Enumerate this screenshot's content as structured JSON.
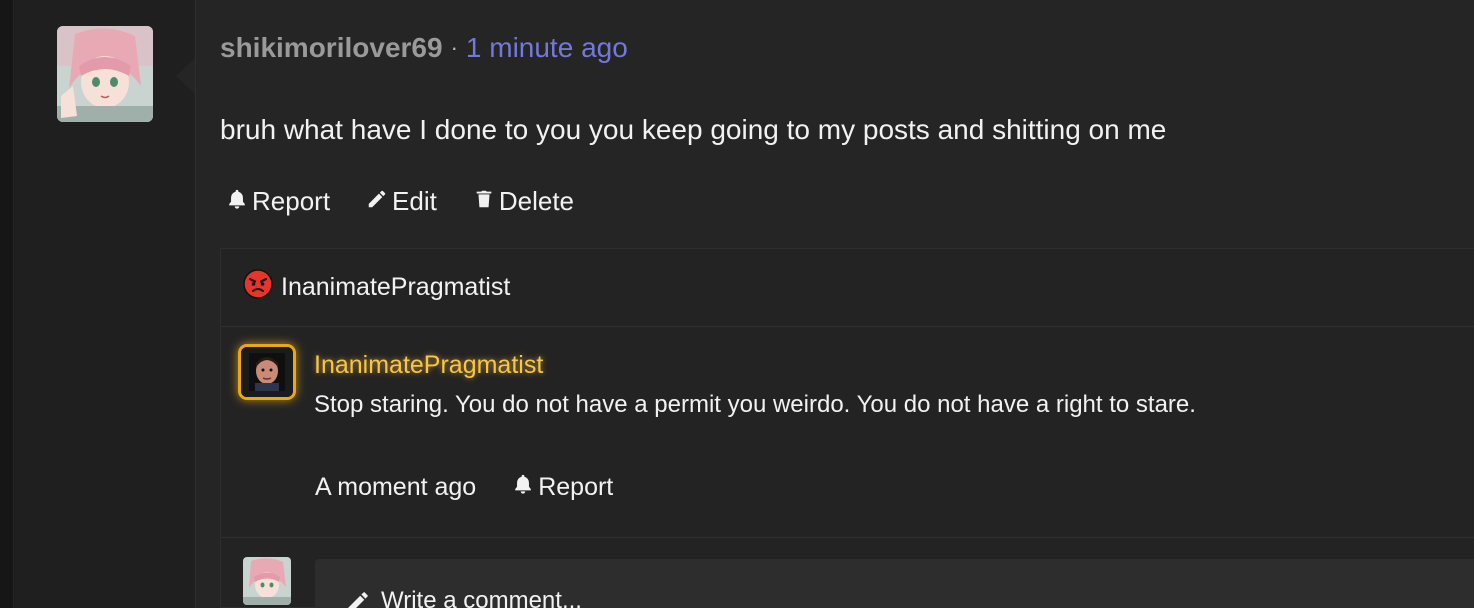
{
  "post": {
    "author": "shikimorilover69",
    "separator": "·",
    "timestamp": "1 minute ago",
    "body": "bruh what have I done to you you keep going to my posts and shitting on me",
    "actions": {
      "report": "Report",
      "edit": "Edit",
      "delete": "Delete"
    }
  },
  "reaction": {
    "icon": "angry-face-icon",
    "user": "InanimatePragmatist"
  },
  "reply": {
    "author": "InanimatePragmatist",
    "text": "Stop staring. You do not have a permit you weirdo. You do not have a right to stare.",
    "timestamp": "A moment ago",
    "report_label": "Report"
  },
  "comment_box": {
    "placeholder": "Write a comment..."
  },
  "colors": {
    "timestamp": "#7279d8",
    "reply_author": "#f5c64a",
    "reply_avatar_glow": "#e8a81a"
  }
}
